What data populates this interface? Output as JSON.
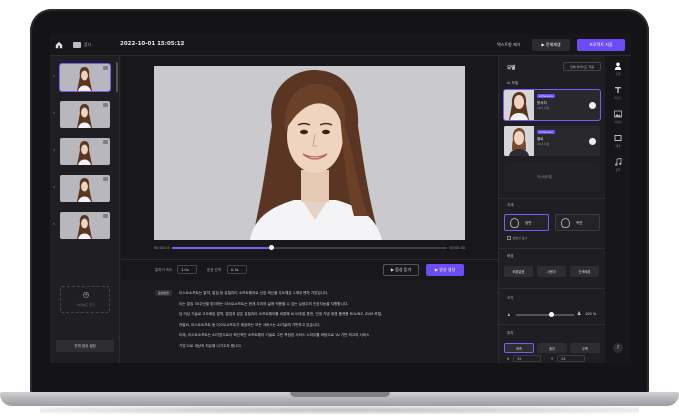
{
  "topbar": {
    "folder_label": "폴더",
    "project_date": "2022-10-01 15:05:12",
    "caption_link": "텍스트형 제거",
    "play_all_label": "▶ 전체재생",
    "export_label": "프로젝트 저장"
  },
  "slides": {
    "items": [
      {
        "num": "1",
        "active": true
      },
      {
        "num": "2",
        "active": false
      },
      {
        "num": "3",
        "active": false
      },
      {
        "num": "4",
        "active": false
      },
      {
        "num": "5",
        "active": false
      }
    ],
    "add_label": "슬라이드 추가",
    "full_edit_label": "전체 영상 설정"
  },
  "player": {
    "current_time": "00:00:03",
    "total_time": "00:00:40",
    "progress": 0.36,
    "speed_label": "말하기 속도",
    "speed_value": "1.0x",
    "pause_label": "문장 간격",
    "pause_value": "0.3s",
    "voice_button": "▶ 음성 듣기",
    "preview_button": "▶ 영상 생성"
  },
  "script": {
    "tag": "음성변환",
    "lines": [
      "이스트소프트는 알약, 알집 등 유틸리티 소프트웨어로 산업 혁신을 주도해온 1세대 벤처 기업입니다.",
      "이는 알집 30주년을 맞이하는 이스트소프트는 현재 우리의 삶에 적용할 수 있는 실생주의 인공지능을 지향합니다.",
      "딥 러닝 기술로 고도화된 알약, 알집과 같은 유틸리티 소프트웨어를 비롯해 AI 버추얼 휴먼, 인생 기념 위젯 플랫폼 ROUNZ, ZUM 포털,",
      "카발M, 이스트소프트 등 이스트소프트가 제공하는 모든 서비스는 AI기술에 기반하고 있습니다.",
      "이제, 이스트소프트는 AI기업으로서 혁신적인 소프트웨어 기술로 그린 측정된 서비스 노하우를 바탕으로 'AI 기반 최고의 서비스",
      "기업'으로 세상의 치유해 나가고자 합니다."
    ]
  },
  "right_panel": {
    "title": "모델",
    "title_button": "전체 슬라이드 적용",
    "ai_models_label": "AI 모델",
    "models": [
      {
        "badge": "AI Persona",
        "name": "윤서지",
        "sub": "20대 여성",
        "selected": true
      },
      {
        "badge": "AI Persona",
        "name": "멜로",
        "sub": "20대 여성",
        "selected": false
      }
    ],
    "placeholder_label": "커스텀모델",
    "pose_section": "자세",
    "poses": [
      "정면",
      "측면"
    ],
    "checkbox_label": "상반신 표시",
    "background_section": "배경",
    "backgrounds": [
      "배경없음",
      "사용자",
      "단색배경"
    ],
    "size_section": "크기",
    "size_value": "100",
    "size_unit": "%",
    "size_level": 0.62,
    "position_section": "위치",
    "positions": [
      "좌측",
      "중앙",
      "우측"
    ],
    "coord_x_label": "X",
    "coord_x": "32",
    "coord_y_label": "Y",
    "coord_y": "24"
  },
  "rail": {
    "items": [
      "모델",
      "텍스트",
      "이미지",
      "배경",
      "음악"
    ],
    "help": "?"
  },
  "colors": {
    "accent": "#6b4cf6",
    "panel": "#1f1f23",
    "background": "#18181b"
  }
}
